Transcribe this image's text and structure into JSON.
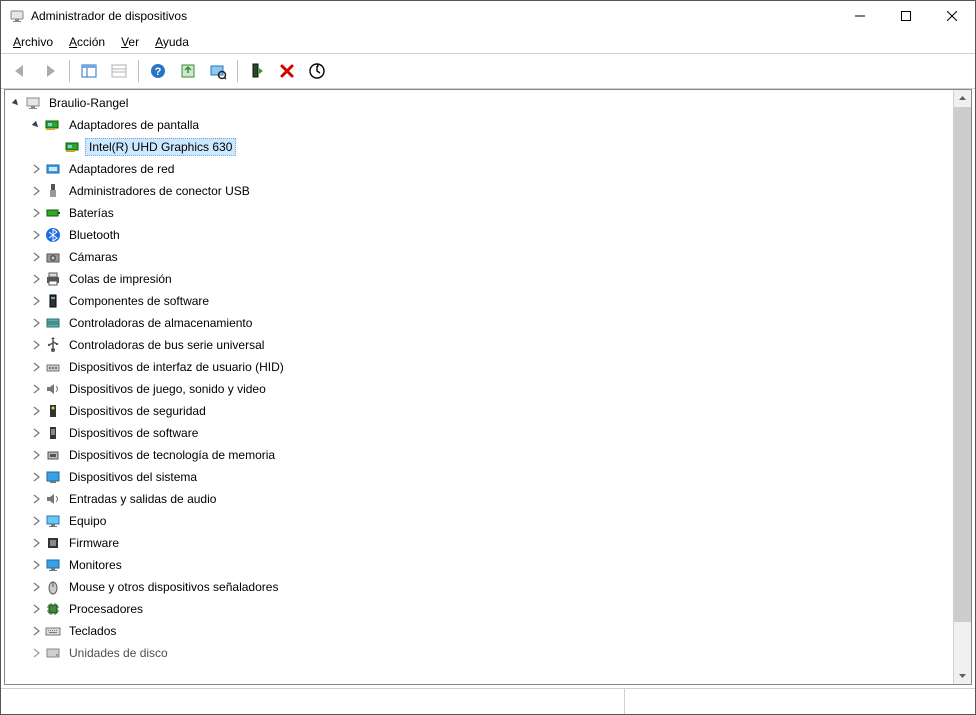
{
  "window": {
    "title": "Administrador de dispositivos"
  },
  "menu": {
    "file_pre": "A",
    "file_post": "rchivo",
    "action_pre": "A",
    "action_post": "cción",
    "view_pre": "V",
    "view_post": "er",
    "help_pre": "A",
    "help_post": "yuda"
  },
  "toolbar": {
    "back": "back-icon",
    "forward": "forward-icon",
    "show_hide": "show-hide-pane-icon",
    "properties": "properties-icon",
    "help": "help-icon",
    "update": "update-driver-icon",
    "scan": "scan-hardware-icon",
    "uninstall1": "enable-device-icon",
    "uninstall2": "uninstall-icon",
    "refresh": "refresh-icon"
  },
  "tree": {
    "root": "Braulio-Rangel",
    "display_adapters": {
      "label": "Adaptadores de pantalla",
      "child": "Intel(R) UHD Graphics 630"
    },
    "items": [
      "Adaptadores de red",
      "Administradores de conector USB",
      "Baterías",
      "Bluetooth",
      "Cámaras",
      "Colas de impresión",
      "Componentes de software",
      "Controladoras de almacenamiento",
      "Controladoras de bus serie universal",
      "Dispositivos de interfaz de usuario (HID)",
      "Dispositivos de juego, sonido y video",
      "Dispositivos de seguridad",
      "Dispositivos de software",
      "Dispositivos de tecnología de memoria",
      "Dispositivos del sistema",
      "Entradas y salidas de audio",
      "Equipo",
      "Firmware",
      "Monitores",
      "Mouse y otros dispositivos señaladores",
      "Procesadores",
      "Teclados",
      "Unidades de disco"
    ]
  }
}
